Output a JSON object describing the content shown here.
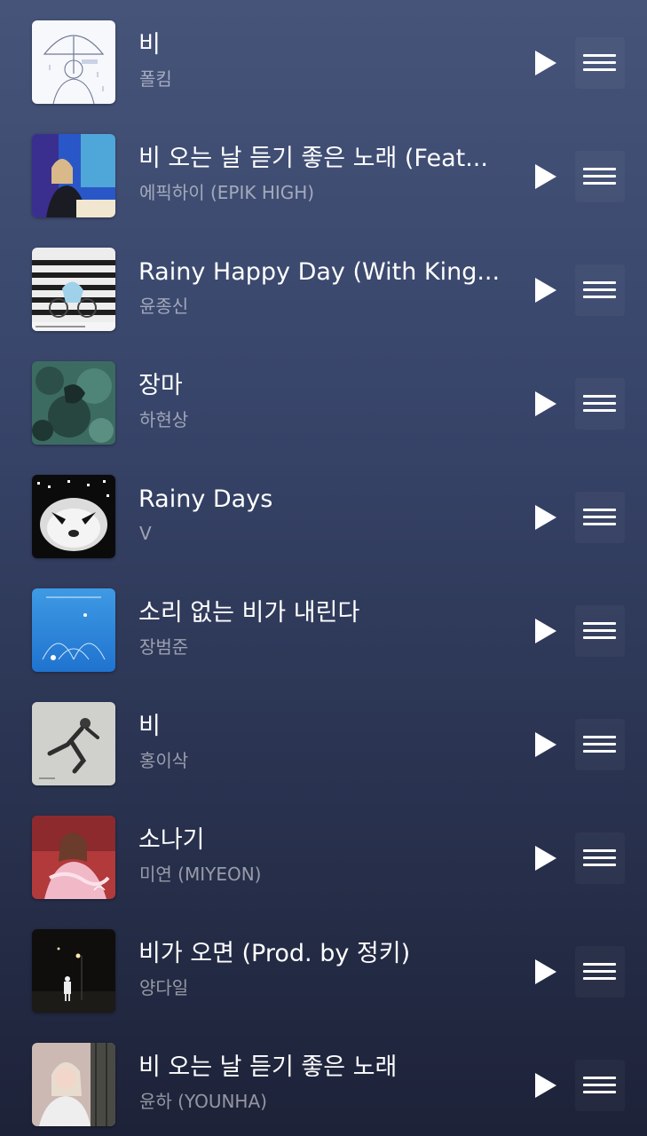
{
  "icons": {
    "play": "play-icon",
    "drag_handle": "drag-handle-icon"
  },
  "colors": {
    "background_top": "#46547a",
    "background_bottom": "#1d2238",
    "title_text": "#ffffff",
    "artist_text": "#9aa1b8"
  },
  "songs": [
    {
      "title": "비",
      "artist": "폴킴"
    },
    {
      "title": "비 오는 날 듣기 좋은 노래 (Feat...",
      "artist": "에픽하이 (EPIK HIGH)"
    },
    {
      "title": "Rainy Happy Day (With King...",
      "artist": "윤종신"
    },
    {
      "title": "장마",
      "artist": "하현상"
    },
    {
      "title": "Rainy Days",
      "artist": "V"
    },
    {
      "title": "소리 없는 비가 내린다",
      "artist": "장범준"
    },
    {
      "title": "비",
      "artist": "홍이삭"
    },
    {
      "title": "소나기",
      "artist": "미연 (MIYEON)"
    },
    {
      "title": "비가 오면 (Prod. by 정키)",
      "artist": "양다일"
    },
    {
      "title": "비 오는 날 듣기 좋은 노래",
      "artist": "윤하 (YOUNHA)"
    }
  ]
}
